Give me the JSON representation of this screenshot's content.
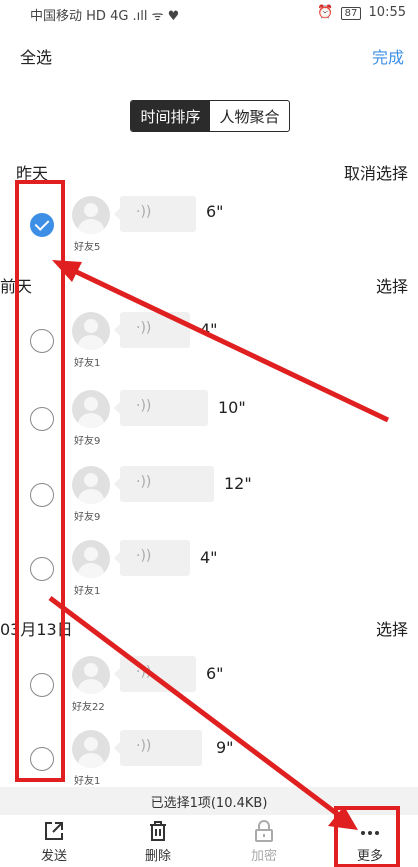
{
  "status_bar": {
    "carrier": "中国移动",
    "indicators": "HD 4G .ıll ᯤ ♥",
    "alarm": "⏰",
    "battery": "87",
    "time": "10:55"
  },
  "header": {
    "select_all": "全选",
    "done": "完成"
  },
  "segment": {
    "items": [
      "时间排序",
      "人物聚合"
    ],
    "active_index": 0
  },
  "sections": [
    {
      "date": "昨天",
      "action": "取消选择",
      "items": [
        {
          "friend": "好友5",
          "duration": "6\"",
          "checked": true
        }
      ]
    },
    {
      "date": "前天",
      "action": "选择",
      "items": [
        {
          "friend": "好友1",
          "duration": "4\"",
          "checked": false
        },
        {
          "friend": "好友9",
          "duration": "10\"",
          "checked": false
        },
        {
          "friend": "好友9",
          "duration": "12\"",
          "checked": false
        },
        {
          "friend": "好友1",
          "duration": "4\"",
          "checked": false
        }
      ]
    },
    {
      "date": "03月13日",
      "action": "选择",
      "items": [
        {
          "friend": "好友22",
          "duration": "6\"",
          "checked": false
        },
        {
          "friend": "好友1",
          "duration": "9\"",
          "checked": false
        }
      ]
    }
  ],
  "selection_summary": "已选择1项(10.4KB)",
  "toolbar": {
    "items": [
      {
        "label": "发送",
        "icon": "share-icon",
        "enabled": true
      },
      {
        "label": "删除",
        "icon": "trash-icon",
        "enabled": true
      },
      {
        "label": "加密",
        "icon": "lock-icon",
        "enabled": false
      },
      {
        "label": "更多",
        "icon": "more-icon",
        "enabled": true
      }
    ]
  },
  "colors": {
    "accent": "#3d8fe6",
    "annotation": "#e02020"
  }
}
